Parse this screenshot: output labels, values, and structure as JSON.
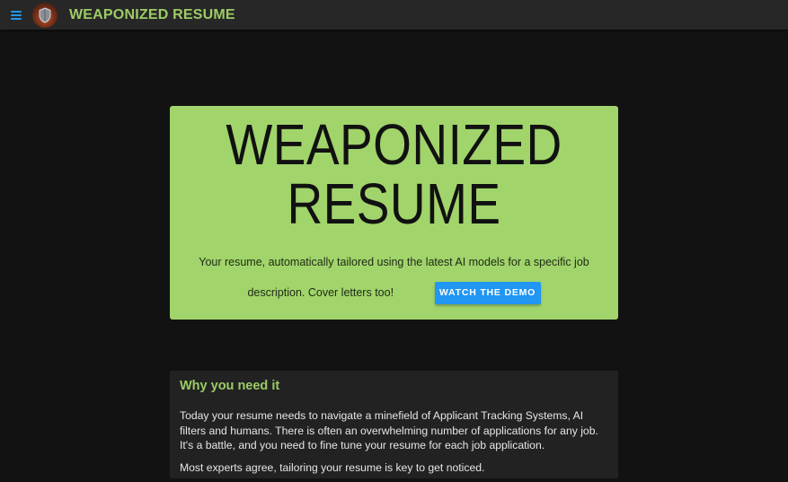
{
  "appbar": {
    "menu_icon": "hamburger-menu-icon",
    "logo_icon": "shield-logo-icon",
    "title": "WEAPONIZED RESUME"
  },
  "hero": {
    "title_line1": "WEAPONIZED",
    "title_line2": "RESUME",
    "subtitle_line1": "Your resume, automatically tailored using the latest AI models for a specific job",
    "subtitle_line2": "description. Cover letters too!",
    "demo_button_label": "WATCH THE DEMO"
  },
  "why_card": {
    "title": "Why you need it",
    "paragraph1": "Today your resume needs to navigate a minefield of Applicant Tracking Systems, AI filters and humans. There is often an overwhelming number of applications for any job. It's a battle, and you need to fine tune your resume for each job application.",
    "paragraph2": "Most experts agree, tailoring your resume is key to get noticed."
  },
  "colors": {
    "accent_green": "#9ccc65",
    "hero_background": "#a1d46b",
    "button_blue": "#2196f3",
    "page_background": "#121212"
  }
}
